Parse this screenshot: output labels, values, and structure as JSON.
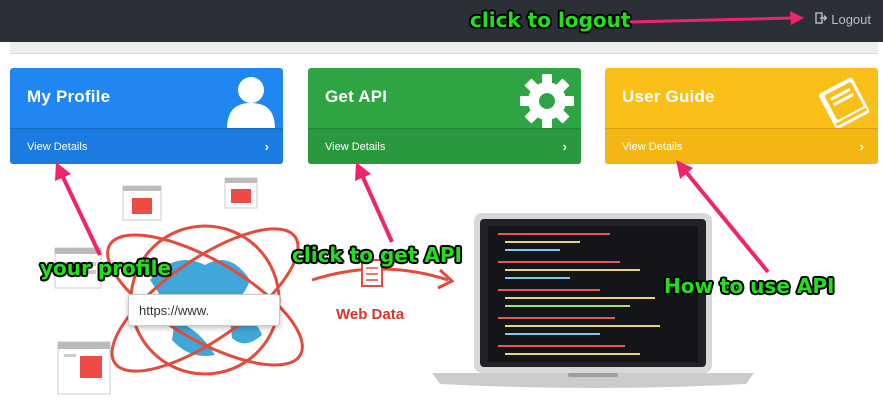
{
  "navbar": {
    "logout_label": "Logout",
    "logout_icon": "sign-out-icon"
  },
  "cards": [
    {
      "title": "My Profile",
      "details_label": "View Details",
      "icon": "user-icon",
      "color": "#1f86f2"
    },
    {
      "title": "Get API",
      "details_label": "View Details",
      "icon": "gear-icon",
      "color": "#2ea443"
    },
    {
      "title": "User Guide",
      "details_label": "View Details",
      "icon": "book-icon",
      "color": "#fbbf1a"
    }
  ],
  "annotations": {
    "logout": "click to logout",
    "profile": "your profile",
    "get_api": "click to get API",
    "guide": "How to use API"
  },
  "illustration": {
    "url_text": "https://www.",
    "web_data_label": "Web Data"
  },
  "colors": {
    "navbar": "#2b2f36",
    "annotation_text": "#22e01a",
    "arrow": "#f0246b"
  }
}
